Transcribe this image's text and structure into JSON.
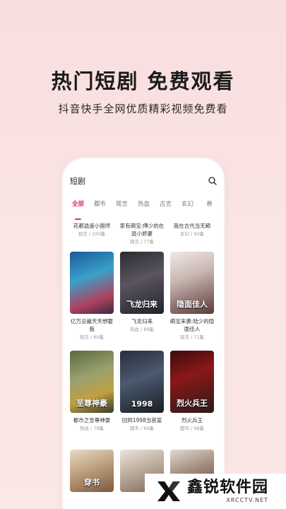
{
  "hero": {
    "title": "热门短剧 免费观看",
    "subtitle": "抖音快手全网优质精彩视频免费看"
  },
  "search": {
    "title": "短剧",
    "icon": "search-icon"
  },
  "tabs": [
    "全部",
    "都市",
    "现言",
    "热血",
    "古言",
    "玄幻",
    "悬"
  ],
  "active_tab": "全部",
  "row1": [
    {
      "title": "花都逍遥小国师",
      "meta": "现言 / 100集"
    },
    {
      "title": "家有萌宝:傅少的在逃小娇妻",
      "meta": "现言 / 77集"
    },
    {
      "title": "我在古代当无赖",
      "meta": "玄幻 / 90集"
    }
  ],
  "row2": [
    {
      "title": "亿万总裁天天想娶我",
      "meta": "现言 / 80集",
      "poster_text": ""
    },
    {
      "title": "飞龙归来",
      "meta": "热血 / 89集",
      "poster_text": "飞龙归来"
    },
    {
      "title": "萌宝来袭:陆少的隐面佳人",
      "meta": "现言 / 71集",
      "poster_text": "隐面佳人"
    }
  ],
  "row3": [
    {
      "title": "都市之至尊神豪",
      "meta": "热血 / 79集",
      "poster_text": "至尊神豪"
    },
    {
      "title": "回到1998当首富",
      "meta": "都市 / 60集",
      "poster_text": "1998"
    },
    {
      "title": "烈火兵王",
      "meta": "都市 / 98集",
      "poster_text": "烈火兵王"
    }
  ],
  "row4": [
    {
      "poster_text": "穿书"
    },
    {
      "poster_text": ""
    },
    {
      "poster_text": ""
    }
  ],
  "watermark": {
    "name": "鑫锐软件园",
    "url": "XRCCTV.NET"
  },
  "colors": {
    "accent": "#e0345a",
    "background": "#f9dede"
  }
}
